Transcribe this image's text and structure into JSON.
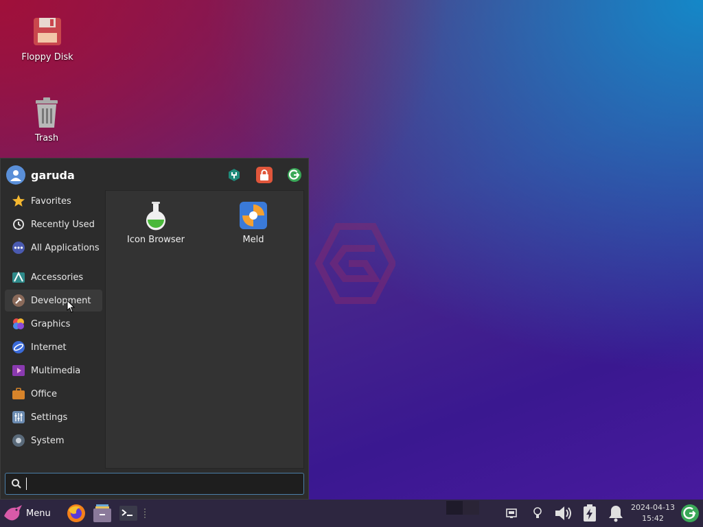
{
  "desktop": {
    "icons": [
      {
        "label": "Floppy Disk"
      },
      {
        "label": "Trash"
      }
    ]
  },
  "menu": {
    "username": "garuda",
    "header_buttons": [
      "settings-manager-icon",
      "lock-icon",
      "logout-icon"
    ],
    "categories": [
      {
        "label": "Favorites",
        "icon": "star-icon"
      },
      {
        "label": "Recently Used",
        "icon": "clock-icon"
      },
      {
        "label": "All Applications",
        "icon": "all-apps-icon"
      },
      {
        "label": "Accessories",
        "icon": "accessories-icon"
      },
      {
        "label": "Development",
        "icon": "development-icon",
        "active": true
      },
      {
        "label": "Graphics",
        "icon": "graphics-icon"
      },
      {
        "label": "Internet",
        "icon": "internet-icon"
      },
      {
        "label": "Multimedia",
        "icon": "multimedia-icon"
      },
      {
        "label": "Office",
        "icon": "office-icon"
      },
      {
        "label": "Settings",
        "icon": "settings-icon"
      },
      {
        "label": "System",
        "icon": "system-icon"
      }
    ],
    "apps": [
      {
        "label": "Icon Browser",
        "icon": "flask-icon"
      },
      {
        "label": "Meld",
        "icon": "meld-icon"
      }
    ],
    "search": {
      "value": "",
      "placeholder": ""
    }
  },
  "taskbar": {
    "menu_label": "Menu",
    "clock_date": "2024-04-13",
    "clock_time": "15:42"
  },
  "colors": {
    "accent": "#4b7fa8",
    "panel": "#2c2c2c",
    "taskbar": "#2d2640"
  }
}
